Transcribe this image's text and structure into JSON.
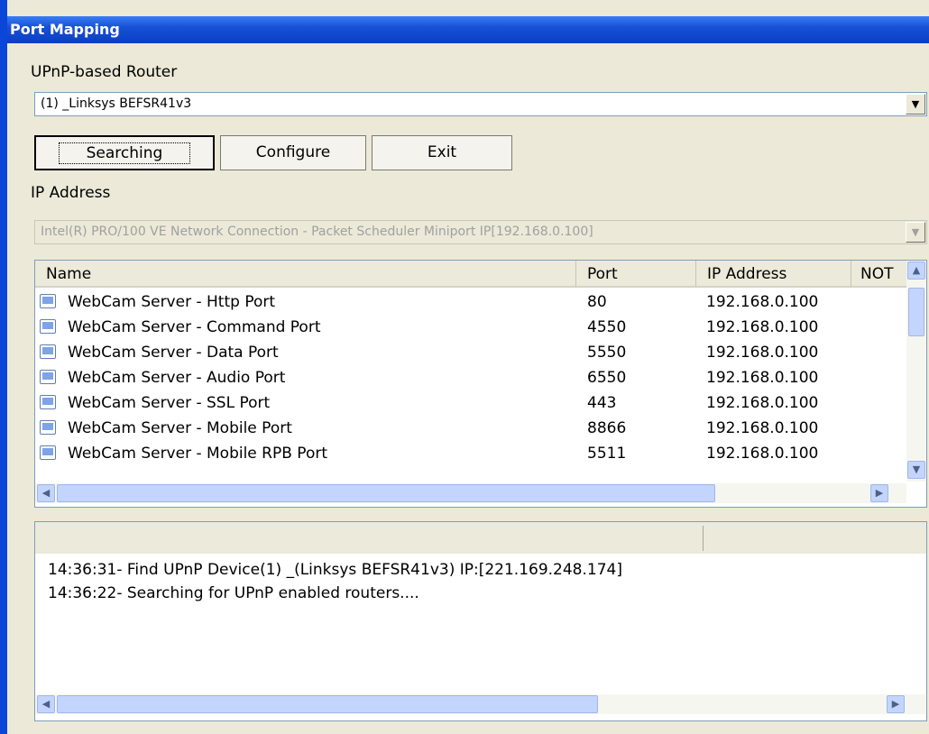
{
  "window": {
    "title": "Port Mapping"
  },
  "router": {
    "label": "UPnP-based Router",
    "selected": "(1) _Linksys BEFSR41v3",
    "arrow": "▼"
  },
  "buttons": {
    "searching": "Searching",
    "configure": "Configure",
    "exit": "Exit"
  },
  "ip": {
    "label": "IP Address",
    "selected": "Intel(R) PRO/100 VE Network Connection - Packet Scheduler Miniport  IP[192.168.0.100]",
    "arrow": "▼"
  },
  "table": {
    "columns": [
      "Name",
      "Port",
      "IP Address",
      "NOT"
    ],
    "rows": [
      {
        "name": "WebCam Server - Http Port",
        "port": "80",
        "ip": "192.168.0.100"
      },
      {
        "name": "WebCam Server - Command Port",
        "port": "4550",
        "ip": "192.168.0.100"
      },
      {
        "name": "WebCam Server - Data Port",
        "port": "5550",
        "ip": "192.168.0.100"
      },
      {
        "name": "WebCam Server - Audio Port",
        "port": "6550",
        "ip": "192.168.0.100"
      },
      {
        "name": "WebCam Server - SSL Port",
        "port": "443",
        "ip": "192.168.0.100"
      },
      {
        "name": "WebCam Server - Mobile Port",
        "port": "8866",
        "ip": "192.168.0.100"
      },
      {
        "name": "WebCam Server - Mobile RPB Port",
        "port": "5511",
        "ip": "192.168.0.100"
      }
    ]
  },
  "log": {
    "lines": [
      "14:36:31- Find UPnP Device(1) _(Linksys BEFSR41v3) IP:[221.169.248.174]",
      "14:36:22- Searching for UPnP enabled routers...."
    ]
  },
  "scroll": {
    "up": "▲",
    "down": "▼",
    "left": "◀",
    "right": "▶"
  }
}
